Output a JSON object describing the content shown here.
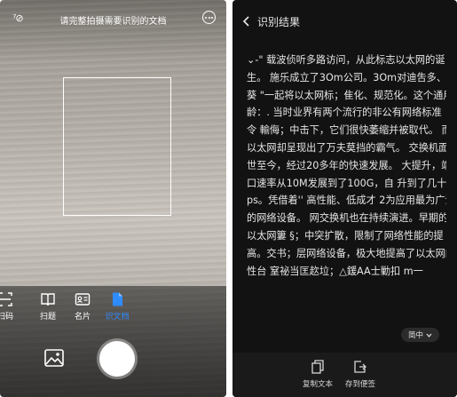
{
  "camera": {
    "flash_label": "⁷⊘",
    "title": "请完整拍摄需要识别的文档",
    "modes": [
      {
        "label": "扫码"
      },
      {
        "label": "扫题"
      },
      {
        "label": "名片"
      },
      {
        "label": "识文档"
      }
    ],
    "accent": "#2f8cff"
  },
  "result": {
    "title": "识别结果",
    "lines": [
      "⌄-\" 载波侦听多路访问，从此标志以太网的诞",
      "生。 施乐成立了3Om公司。3Om对迪吿多、",
      "葵 \"一起将以太网标；隹化、规范化。这个通用",
      "龄：. 当时业界有两个流行的非公有网络标准",
      "令 輸侮；中击下，它们很快萎缩并被取代。 而",
      "以太网却呈现出了万夫莫挡的霸气。 交换机面",
      "世至今，经过20多年的快速发展。 大提升，端",
      "口速率从10M发展到了100G，自 升到了几十西",
      "ps。凭借着'' 高性能、低成才 2为应用最为广泛",
      "的网络设备。 网交换机也在持续演进。早期的",
      "以太网簍 §；中突扩散，限制了网络性能的提",
      "高。交书；层网络设备，极大地提高了以太网的",
      "性台    窒祕当匡赼垃；△鍰AA士勦扣  m一"
    ],
    "lang_label": "简中",
    "toolbar": {
      "copy_label": "复制文本",
      "save_label": "存到便签"
    }
  }
}
